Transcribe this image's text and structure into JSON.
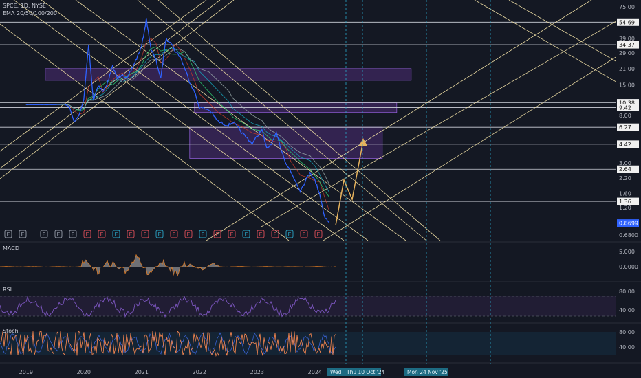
{
  "header": {
    "symbol_line": "SPCE, 1D, NYSE",
    "indicator_line": "EMA 20/50/100/200"
  },
  "colors": {
    "background": "#141823",
    "price_line": "#2f62ff",
    "trend_lines": "#e8d8a0",
    "zones": "#6c3aa6",
    "projection": "#e5b25d",
    "macd_fill": "#b9b9b9",
    "rsi_line": "#7e57c2",
    "rsi_band": "#241f38",
    "stoch_k": "#ff8a50",
    "stoch_d": "#3a63d6",
    "stoch_band": "#142636",
    "highlight": "#2aa7c9"
  },
  "chart_data": {
    "type": "line",
    "price_axis": {
      "ticks": [
        "75.00",
        "54.69",
        "39.00",
        "34.37",
        "29.00",
        "21.00",
        "15.00",
        "10.38",
        "9.42",
        "8.00",
        "6.27",
        "4.42",
        "3.00",
        "2.64",
        "2.20",
        "1.60",
        "1.36",
        "1.20",
        "0.8699",
        "0.6800"
      ],
      "highlighted": [
        "54.69",
        "34.37",
        "10.38",
        "9.42",
        "6.27",
        "4.42",
        "2.64",
        "1.36",
        "0.8699"
      ],
      "scale": "log"
    },
    "time_axis": {
      "ticks": [
        "2019",
        "2020",
        "2021",
        "2022",
        "2023",
        "2024"
      ],
      "markers": [
        "Wed",
        "Thu 10 Oct '24",
        "Mon 24 Nov '25"
      ]
    },
    "series": [
      {
        "values": [
          [
            "2019-01",
            10.0
          ],
          [
            "2019-06",
            10.0
          ],
          [
            "2019-09",
            10.1
          ],
          [
            "2019-10",
            9.6
          ],
          [
            "2019-11",
            7.0
          ],
          [
            "2019-12",
            8.0
          ],
          [
            "2020-01",
            11.0
          ],
          [
            "2020-02",
            34.37
          ],
          [
            "2020-03",
            11.0
          ],
          [
            "2020-04",
            15.0
          ],
          [
            "2020-05",
            13.0
          ],
          [
            "2020-06",
            16.0
          ],
          [
            "2020-07",
            22.0
          ],
          [
            "2020-08",
            17.0
          ],
          [
            "2020-09",
            19.0
          ],
          [
            "2020-10",
            17.0
          ],
          [
            "2020-11",
            21.0
          ],
          [
            "2020-12",
            26.0
          ],
          [
            "2021-01",
            33.0
          ],
          [
            "2021-02",
            58.0
          ],
          [
            "2021-03",
            31.0
          ],
          [
            "2021-04",
            25.0
          ],
          [
            "2021-05",
            17.0
          ],
          [
            "2021-06",
            38.0
          ],
          [
            "2021-07",
            37.0
          ],
          [
            "2021-08",
            30.0
          ],
          [
            "2021-09",
            27.0
          ],
          [
            "2021-10",
            21.0
          ],
          [
            "2021-11",
            16.0
          ],
          [
            "2021-12",
            13.0
          ],
          [
            "2022-01",
            9.5
          ],
          [
            "2022-03",
            9.0
          ],
          [
            "2022-05",
            7.0
          ],
          [
            "2022-07",
            6.5
          ],
          [
            "2022-08",
            7.0
          ],
          [
            "2022-10",
            5.5
          ],
          [
            "2022-12",
            4.5
          ],
          [
            "2023-02",
            6.0
          ],
          [
            "2023-03",
            4.0
          ],
          [
            "2023-04",
            4.5
          ],
          [
            "2023-05",
            5.5
          ],
          [
            "2023-06",
            4.0
          ],
          [
            "2023-07",
            3.0
          ],
          [
            "2023-08",
            2.5
          ],
          [
            "2023-10",
            1.7
          ],
          [
            "2023-12",
            2.5
          ],
          [
            "2024-01",
            2.1
          ],
          [
            "2024-02",
            1.6
          ],
          [
            "2024-03",
            1.0
          ],
          [
            "2024-04",
            0.8699
          ]
        ]
      }
    ],
    "zones": [
      {
        "from": "2019-05",
        "to": "2025-09",
        "low": 16.5,
        "high": 21.0
      },
      {
        "from": "2021-12",
        "to": "2025-06",
        "low": 8.5,
        "high": 10.38
      },
      {
        "from": "2021-11",
        "to": "2025-03",
        "low": 3.3,
        "high": 6.27
      }
    ],
    "panels": [
      {
        "name": "MACD",
        "ticks": [
          "5.000",
          "0.0000"
        ]
      },
      {
        "name": "RSI",
        "ticks": [
          "80.00",
          "40.00"
        ]
      },
      {
        "name": "Stoch",
        "ticks": [
          "80.00",
          "40.00"
        ]
      }
    ],
    "earnings_markers": [
      "E",
      "E",
      "E",
      "E",
      "E",
      "E",
      "E",
      "E",
      "E",
      "E",
      "E",
      "E",
      "E",
      "E",
      "E",
      "E",
      "E",
      "E",
      "E",
      "E",
      "E",
      "E"
    ]
  }
}
